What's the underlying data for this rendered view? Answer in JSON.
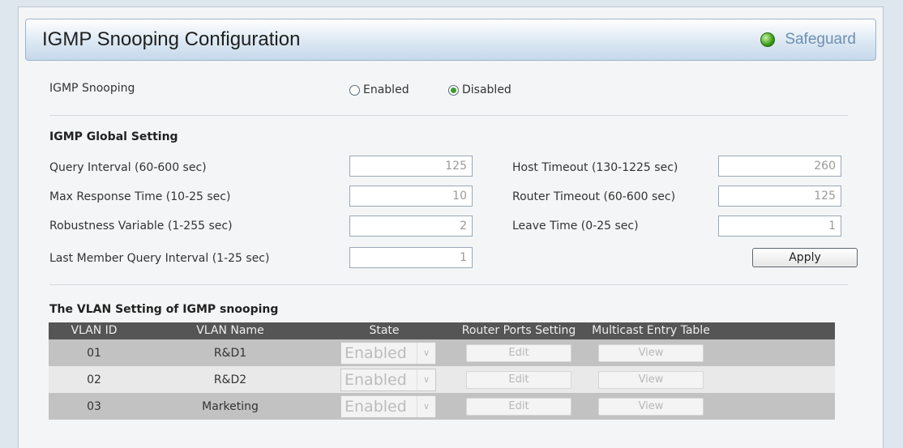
{
  "header": {
    "title": "IGMP Snooping Configuration",
    "safeguard_label": "Safeguard"
  },
  "snooping": {
    "label": "IGMP Snooping",
    "enabled_label": "Enabled",
    "disabled_label": "Disabled",
    "selected": "Disabled"
  },
  "global": {
    "heading": "IGMP Global Setting",
    "query_interval": {
      "label": "Query Interval (60-600 sec)",
      "value": "125"
    },
    "max_response": {
      "label": "Max Response Time (10-25 sec)",
      "value": "10"
    },
    "robustness": {
      "label": "Robustness Variable (1-255 sec)",
      "value": "2"
    },
    "last_member": {
      "label": "Last Member Query Interval (1-25 sec)",
      "value": "1"
    },
    "host_timeout": {
      "label": "Host Timeout (130-1225 sec)",
      "value": "260"
    },
    "router_timeout": {
      "label": "Router Timeout (60-600 sec)",
      "value": "125"
    },
    "leave_time": {
      "label": "Leave Time (0-25 sec)",
      "value": "1"
    },
    "apply_label": "Apply"
  },
  "vlan": {
    "heading": "The VLAN Setting of IGMP snooping",
    "columns": [
      "VLAN ID",
      "VLAN Name",
      "State",
      "Router Ports Setting",
      "Multicast Entry Table"
    ],
    "rows": [
      {
        "id": "01",
        "name": "R&D1",
        "state": "Enabled",
        "edit": "Edit",
        "view": "View"
      },
      {
        "id": "02",
        "name": "R&D2",
        "state": "Enabled",
        "edit": "Edit",
        "view": "View"
      },
      {
        "id": "03",
        "name": "Marketing",
        "state": "Enabled",
        "edit": "Edit",
        "view": "View"
      }
    ]
  },
  "colors": {
    "header_bg": "#c5d8ea",
    "table_head": "#555555",
    "row_odd": "#c2c2c2",
    "row_even": "#e9e9e9",
    "safeguard_text": "#6e8fb0"
  }
}
